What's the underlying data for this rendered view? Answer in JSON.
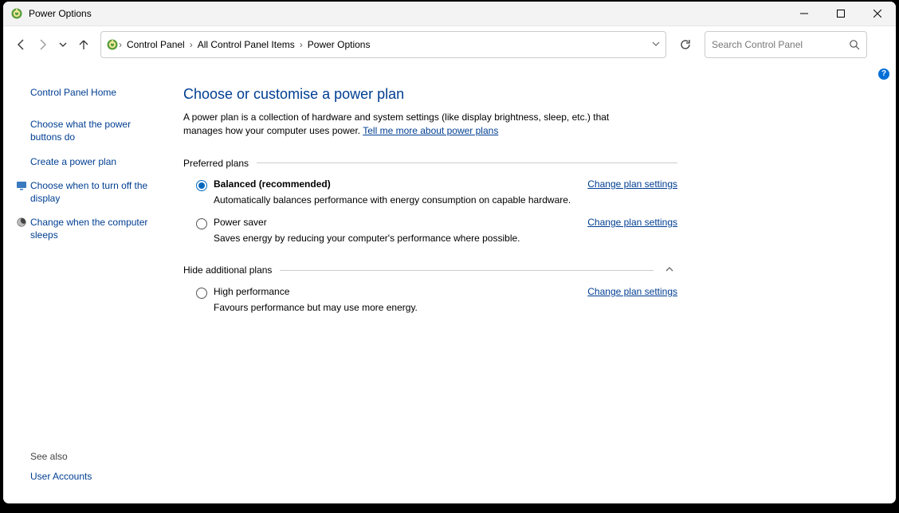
{
  "window": {
    "title": "Power Options"
  },
  "breadcrumbs": {
    "items": [
      "Control Panel",
      "All Control Panel Items",
      "Power Options"
    ]
  },
  "search": {
    "placeholder": "Search Control Panel"
  },
  "sidebar": {
    "home": "Control Panel Home",
    "links": [
      "Choose what the power buttons do",
      "Create a power plan",
      "Choose when to turn off the display",
      "Change when the computer sleeps"
    ],
    "see_also_header": "See also",
    "see_also": [
      "User Accounts"
    ]
  },
  "main": {
    "heading": "Choose or customise a power plan",
    "desc_prefix": "A power plan is a collection of hardware and system settings (like display brightness, sleep, etc.) that manages how your computer uses power. ",
    "desc_link": "Tell me more about power plans",
    "preferred_header": "Preferred plans",
    "hide_header": "Hide additional plans",
    "change_label": "Change plan settings",
    "plans": {
      "balanced": {
        "name": "Balanced (recommended)",
        "desc": "Automatically balances performance with energy consumption on capable hardware."
      },
      "powersaver": {
        "name": "Power saver",
        "desc": "Saves energy by reducing your computer's performance where possible."
      },
      "highperf": {
        "name": "High performance",
        "desc": "Favours performance but may use more energy."
      }
    }
  }
}
